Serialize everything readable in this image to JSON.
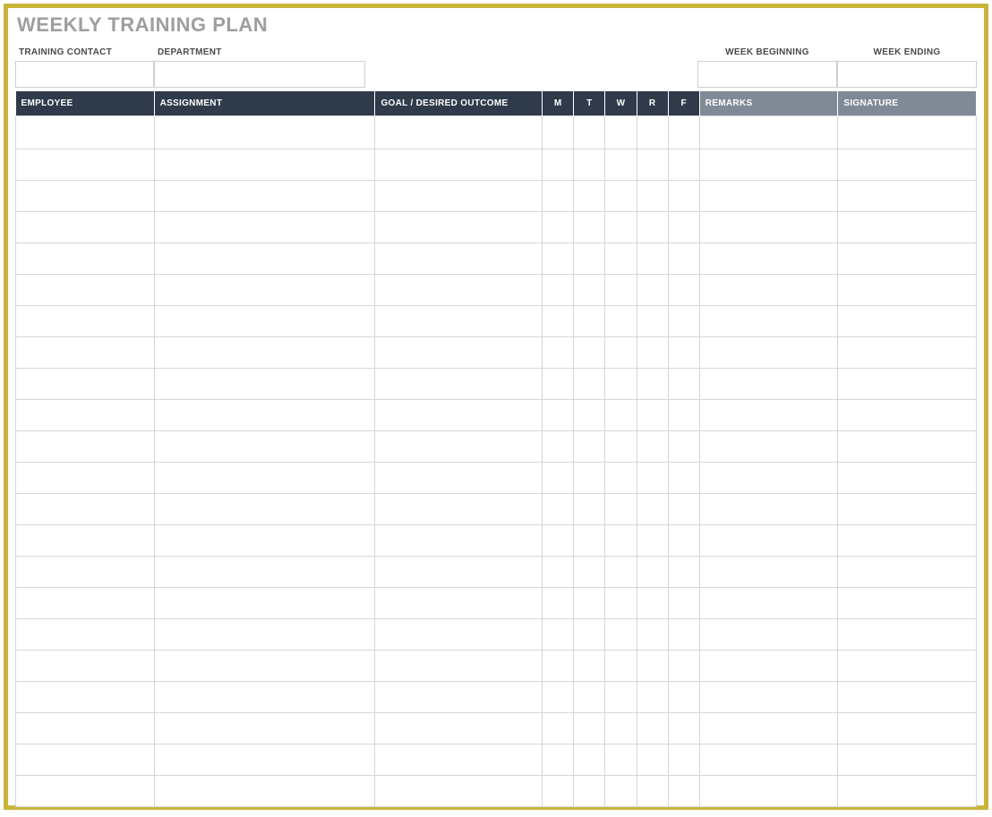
{
  "title": "WEEKLY TRAINING PLAN",
  "meta": {
    "training_contact_label": "TRAINING CONTACT",
    "training_contact_value": "",
    "department_label": "DEPARTMENT",
    "department_value": "",
    "week_beginning_label": "WEEK BEGINNING",
    "week_beginning_value": "",
    "week_ending_label": "WEEK ENDING",
    "week_ending_value": ""
  },
  "columns": {
    "employee": "EMPLOYEE",
    "assignment": "ASSIGNMENT",
    "goal": "GOAL / DESIRED OUTCOME",
    "m": "M",
    "t": "T",
    "w": "W",
    "r": "R",
    "f": "F",
    "remarks": "REMARKS",
    "signature": "SIGNATURE"
  },
  "rows": [
    {
      "employee": "",
      "assignment": "",
      "goal": "",
      "m": "",
      "t": "",
      "w": "",
      "r": "",
      "f": "",
      "remarks": "",
      "signature": ""
    },
    {
      "employee": "",
      "assignment": "",
      "goal": "",
      "m": "",
      "t": "",
      "w": "",
      "r": "",
      "f": "",
      "remarks": "",
      "signature": ""
    },
    {
      "employee": "",
      "assignment": "",
      "goal": "",
      "m": "",
      "t": "",
      "w": "",
      "r": "",
      "f": "",
      "remarks": "",
      "signature": ""
    },
    {
      "employee": "",
      "assignment": "",
      "goal": "",
      "m": "",
      "t": "",
      "w": "",
      "r": "",
      "f": "",
      "remarks": "",
      "signature": ""
    },
    {
      "employee": "",
      "assignment": "",
      "goal": "",
      "m": "",
      "t": "",
      "w": "",
      "r": "",
      "f": "",
      "remarks": "",
      "signature": ""
    },
    {
      "employee": "",
      "assignment": "",
      "goal": "",
      "m": "",
      "t": "",
      "w": "",
      "r": "",
      "f": "",
      "remarks": "",
      "signature": ""
    },
    {
      "employee": "",
      "assignment": "",
      "goal": "",
      "m": "",
      "t": "",
      "w": "",
      "r": "",
      "f": "",
      "remarks": "",
      "signature": ""
    },
    {
      "employee": "",
      "assignment": "",
      "goal": "",
      "m": "",
      "t": "",
      "w": "",
      "r": "",
      "f": "",
      "remarks": "",
      "signature": ""
    },
    {
      "employee": "",
      "assignment": "",
      "goal": "",
      "m": "",
      "t": "",
      "w": "",
      "r": "",
      "f": "",
      "remarks": "",
      "signature": ""
    },
    {
      "employee": "",
      "assignment": "",
      "goal": "",
      "m": "",
      "t": "",
      "w": "",
      "r": "",
      "f": "",
      "remarks": "",
      "signature": ""
    },
    {
      "employee": "",
      "assignment": "",
      "goal": "",
      "m": "",
      "t": "",
      "w": "",
      "r": "",
      "f": "",
      "remarks": "",
      "signature": ""
    },
    {
      "employee": "",
      "assignment": "",
      "goal": "",
      "m": "",
      "t": "",
      "w": "",
      "r": "",
      "f": "",
      "remarks": "",
      "signature": ""
    },
    {
      "employee": "",
      "assignment": "",
      "goal": "",
      "m": "",
      "t": "",
      "w": "",
      "r": "",
      "f": "",
      "remarks": "",
      "signature": ""
    },
    {
      "employee": "",
      "assignment": "",
      "goal": "",
      "m": "",
      "t": "",
      "w": "",
      "r": "",
      "f": "",
      "remarks": "",
      "signature": ""
    },
    {
      "employee": "",
      "assignment": "",
      "goal": "",
      "m": "",
      "t": "",
      "w": "",
      "r": "",
      "f": "",
      "remarks": "",
      "signature": ""
    },
    {
      "employee": "",
      "assignment": "",
      "goal": "",
      "m": "",
      "t": "",
      "w": "",
      "r": "",
      "f": "",
      "remarks": "",
      "signature": ""
    },
    {
      "employee": "",
      "assignment": "",
      "goal": "",
      "m": "",
      "t": "",
      "w": "",
      "r": "",
      "f": "",
      "remarks": "",
      "signature": ""
    },
    {
      "employee": "",
      "assignment": "",
      "goal": "",
      "m": "",
      "t": "",
      "w": "",
      "r": "",
      "f": "",
      "remarks": "",
      "signature": ""
    },
    {
      "employee": "",
      "assignment": "",
      "goal": "",
      "m": "",
      "t": "",
      "w": "",
      "r": "",
      "f": "",
      "remarks": "",
      "signature": ""
    },
    {
      "employee": "",
      "assignment": "",
      "goal": "",
      "m": "",
      "t": "",
      "w": "",
      "r": "",
      "f": "",
      "remarks": "",
      "signature": ""
    },
    {
      "employee": "",
      "assignment": "",
      "goal": "",
      "m": "",
      "t": "",
      "w": "",
      "r": "",
      "f": "",
      "remarks": "",
      "signature": ""
    },
    {
      "employee": "",
      "assignment": "",
      "goal": "",
      "m": "",
      "t": "",
      "w": "",
      "r": "",
      "f": "",
      "remarks": "",
      "signature": ""
    }
  ],
  "watermark": ""
}
